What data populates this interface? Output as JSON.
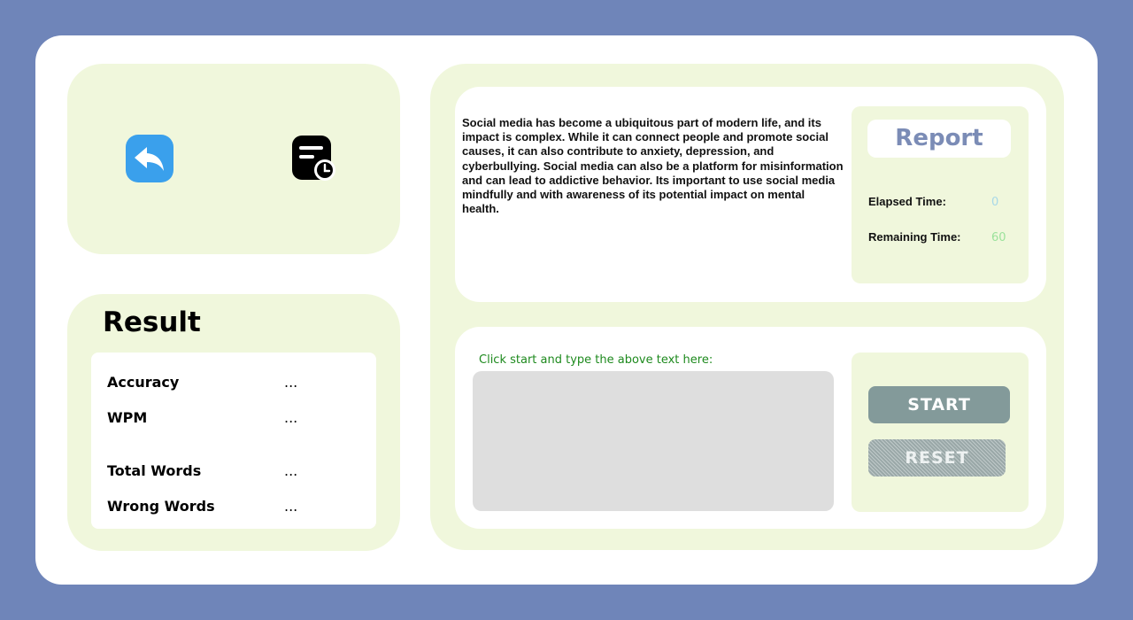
{
  "nav": {
    "back_icon": "reply-arrow-icon",
    "history_icon": "document-clock-icon",
    "back_color": "#3aa0ec"
  },
  "result": {
    "title": "Result",
    "stats": [
      {
        "label": "Accuracy",
        "value": "..."
      },
      {
        "label": "WPM",
        "value": "..."
      },
      {
        "label": "Total Words",
        "value": "..."
      },
      {
        "label": "Wrong Words",
        "value": "..."
      }
    ]
  },
  "passage": "Social media has become a ubiquitous part of modern life, and its impact is complex. While it can connect people and promote social causes, it can also contribute to anxiety, depression, and cyberbullying. Social media can also be a platform for misinformation and can lead to addictive behavior. Its important to use social media mindfully and with awareness of its potential impact on mental health.",
  "report": {
    "title": "Report",
    "elapsed_label": "Elapsed Time:",
    "elapsed_value": "0",
    "remaining_label": "Remaining Time:",
    "remaining_value": "60",
    "elapsed_color": "#a8d8e8",
    "remaining_color": "#9be29b"
  },
  "typing": {
    "prompt": "Click start and type the above text here:",
    "value": "",
    "placeholder": ""
  },
  "controls": {
    "start_label": "START",
    "reset_label": "RESET"
  },
  "colors": {
    "background": "#6f85b9",
    "panel": "#f0f7dc",
    "report_title": "#7b8cb6",
    "prompt": "#1e8a1e"
  }
}
